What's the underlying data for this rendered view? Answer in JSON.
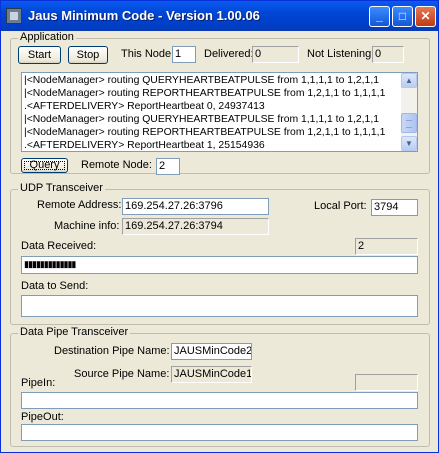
{
  "window": {
    "title": "Jaus Minimum Code - Version 1.00.06"
  },
  "application": {
    "group_label": "Application",
    "start_label": "Start",
    "stop_label": "Stop",
    "this_node_label": "This Node:",
    "this_node_value": "1",
    "delivered_label": "Delivered:",
    "delivered_value": "0",
    "not_listening_label": "Not Listening:",
    "not_listening_value": "0",
    "log_lines": [
      "|<NodeManager> routing QUERYHEARTBEATPULSE from 1,1,1,1 to 1,2,1,1",
      "|<NodeManager> routing REPORTHEARTBEATPULSE from 1,2,1,1 to 1,1,1,1",
      ".<AFTERDELIVERY> ReportHeartbeat 0, 24937413",
      "|<NodeManager> routing QUERYHEARTBEATPULSE from 1,1,1,1 to 1,2,1,1",
      "|<NodeManager> routing REPORTHEARTBEATPULSE from 1,2,1,1 to 1,1,1,1",
      ".<AFTERDELIVERY> ReportHeartbeat 1, 25154936"
    ],
    "query_label": "Query",
    "remote_node_label": "Remote Node:",
    "remote_node_value": "2"
  },
  "udp": {
    "group_label": "UDP Transceiver",
    "remote_address_label": "Remote Address:",
    "remote_address_value": "169.254.27.26:3796",
    "local_port_label": "Local Port:",
    "local_port_value": "3794",
    "machine_info_label": "Machine info:",
    "machine_info_value": "169.254.27.26:3794",
    "data_received_label": "Data Received:",
    "data_received_count": "2",
    "data_received_value": "▮▮▮▮▮▮▮▮▮▮▮▮▮",
    "data_to_send_label": "Data to Send:",
    "data_to_send_value": ""
  },
  "pipe": {
    "group_label": "Data Pipe Transceiver",
    "destination_label": "Destination Pipe Name:",
    "destination_value": "JAUSMinCode2",
    "source_label": "Source Pipe Name:",
    "source_value": "JAUSMinCode1",
    "pipe_in_label": "PipeIn:",
    "pipe_in_count": "",
    "pipe_in_value": "",
    "pipe_out_label": "PipeOut:",
    "pipe_out_value": ""
  },
  "colors": {
    "titlebar": "#0046d5",
    "window_bg": "#ece9d8",
    "close_button": "#c13a14"
  }
}
